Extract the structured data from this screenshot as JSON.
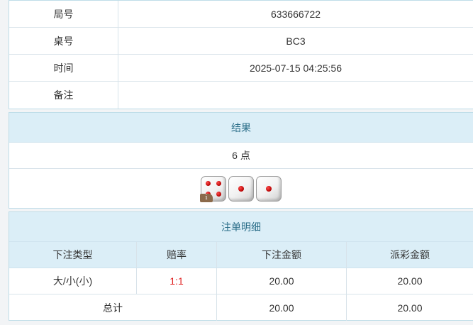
{
  "info": {
    "rows": [
      {
        "label": "局号",
        "value": "633666722"
      },
      {
        "label": "桌号",
        "value": "BC3"
      },
      {
        "label": "时间",
        "value": "2025-07-15 04:25:56"
      },
      {
        "label": "备注",
        "value": ""
      }
    ]
  },
  "result": {
    "title": "结果",
    "text": "6 点",
    "dice": [
      4,
      1,
      1
    ],
    "badge": "i"
  },
  "detail": {
    "title": "注单明细",
    "columns": [
      "下注类型",
      "赔率",
      "下注金额",
      "派彩金额"
    ],
    "rows": [
      {
        "type": "大/小(小)",
        "odds": "1:1",
        "bet": "20.00",
        "payout": "20.00"
      }
    ],
    "total": {
      "label": "总计",
      "bet": "20.00",
      "payout": "20.00"
    }
  },
  "colors": {
    "header_bg": "#dbeef7",
    "header_text": "#2a6d88",
    "odds": "#e02020"
  }
}
